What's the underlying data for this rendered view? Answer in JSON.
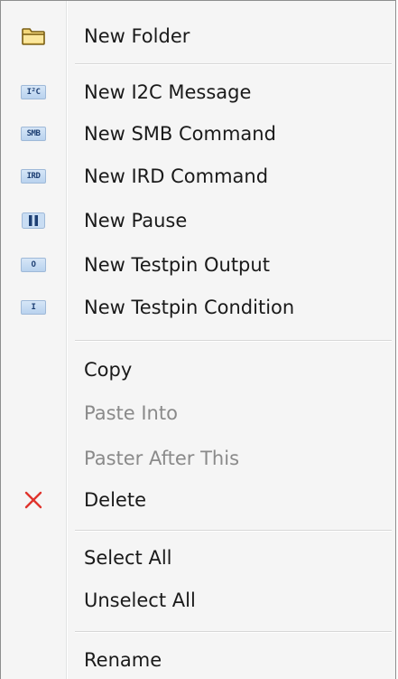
{
  "menu": {
    "items": [
      {
        "label": "New Folder",
        "icon": "folder-icon"
      },
      {
        "label": "New I2C Message",
        "icon": "i2c-icon",
        "icon_text": "I²C"
      },
      {
        "label": "New SMB Command",
        "icon": "smb-icon",
        "icon_text": "SMB"
      },
      {
        "label": "New IRD Command",
        "icon": "ird-icon",
        "icon_text": "IRD"
      },
      {
        "label": "New Pause",
        "icon": "pause-icon"
      },
      {
        "label": "New Testpin Output",
        "icon": "testpin-output-icon",
        "icon_text": "O"
      },
      {
        "label": "New Testpin Condition",
        "icon": "testpin-condition-icon",
        "icon_text": "I"
      },
      {
        "label": "Copy"
      },
      {
        "label": "Paste Into",
        "disabled": true
      },
      {
        "label": "Paster After This",
        "disabled": true
      },
      {
        "label": "Delete",
        "icon": "delete-icon"
      },
      {
        "label": "Select All"
      },
      {
        "label": "Unselect All"
      },
      {
        "label": "Rename"
      }
    ]
  },
  "colors": {
    "background": "#f5f5f5",
    "border": "#8e8f8f",
    "disabled_text": "#8a8a8a",
    "delete_icon": "#e0332c",
    "chip_text": "#1d3f73"
  }
}
